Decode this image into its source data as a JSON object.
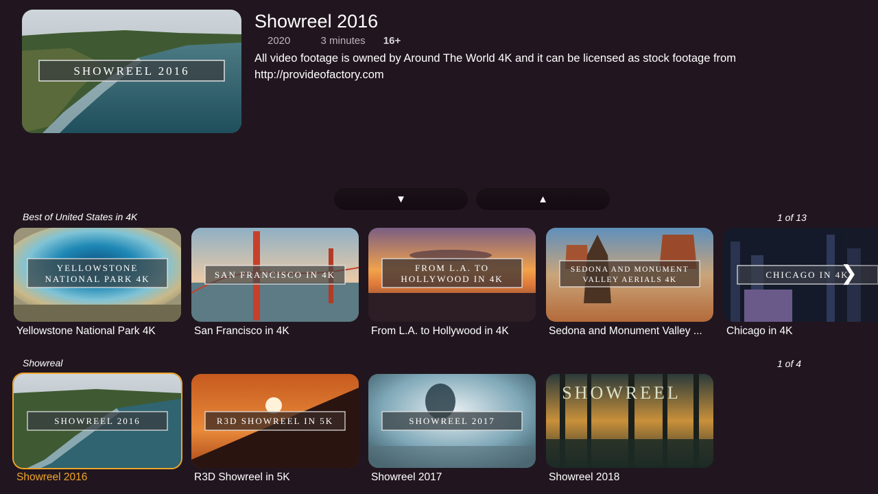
{
  "hero": {
    "title": "Showreel 2016",
    "year": "2020",
    "duration": "3 minutes",
    "rating": "16+",
    "description": "All video footage is owned by Around The World 4K and it can be licensed as stock footage from http://provideofactory.com",
    "thumb_text": "SHOWREEL 2016"
  },
  "nav": {
    "down_icon": "▼",
    "up_icon": "▲",
    "next_icon": "❯"
  },
  "rows": [
    {
      "title": "Best of United States in 4K",
      "count": "1 of 13",
      "items": [
        {
          "label": "Yellowstone National Park 4K",
          "thumb_line1": "YELLOWSTONE",
          "thumb_line2": "NATIONAL PARK 4K"
        },
        {
          "label": "San Francisco in 4K",
          "thumb_line1": "SAN FRANCISCO IN 4K",
          "thumb_line2": ""
        },
        {
          "label": "From L.A. to Hollywood in 4K",
          "thumb_line1": "FROM L.A. TO",
          "thumb_line2": "HOLLYWOOD IN 4K"
        },
        {
          "label": "Sedona and Monument Valley ...",
          "thumb_line1": "SEDONA AND MONUMENT",
          "thumb_line2": "VALLEY AERIALS 4K"
        },
        {
          "label": "Chicago in 4K",
          "thumb_line1": "CHICAGO IN 4K",
          "thumb_line2": ""
        }
      ]
    },
    {
      "title": "Showreal",
      "count": "1 of 4",
      "items": [
        {
          "label": "Showreel 2016",
          "thumb_line1": "SHOWREEL 2016",
          "focused": true
        },
        {
          "label": "R3D Showreel in 5K",
          "thumb_line1": "R3D SHOWREEL IN 5K"
        },
        {
          "label": "Showreel 2017",
          "thumb_line1": "SHOWREEL 2017"
        },
        {
          "label": "Showreel 2018",
          "thumb_line1": "SHOWREEL"
        }
      ]
    }
  ],
  "colors": {
    "background": "#21161f",
    "focus": "#f0a52a"
  }
}
